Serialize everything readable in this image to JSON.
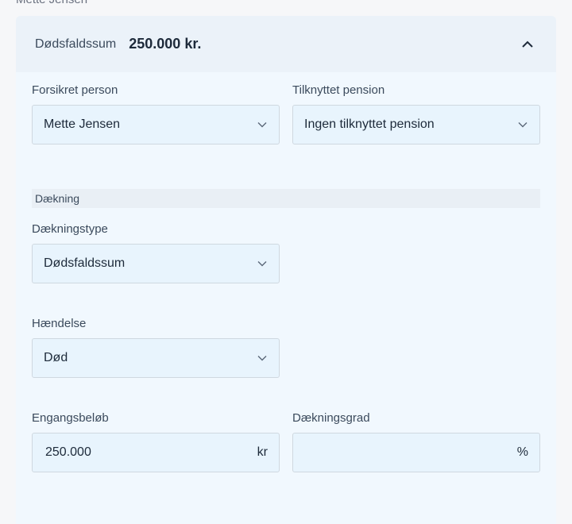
{
  "top_clip": "Mette Jensen",
  "header": {
    "label": "Dødsfaldssum",
    "value": "250.000 kr."
  },
  "fields": {
    "insured_person": {
      "label": "Forsikret person",
      "value": "Mette Jensen"
    },
    "linked_pension": {
      "label": "Tilknyttet pension",
      "value": "Ingen tilknyttet pension"
    },
    "coverage_type": {
      "label": "Dækningstype",
      "value": "Dødsfaldssum"
    },
    "event": {
      "label": "Hændelse",
      "value": "Død"
    },
    "lump_sum": {
      "label": "Engangsbeløb",
      "value": "250.000",
      "suffix": "kr"
    },
    "coverage_degree": {
      "label": "Dækningsgrad",
      "value": "",
      "suffix": "%"
    }
  },
  "section": {
    "title": "Dækning"
  },
  "icons": {
    "collapse": "chevron-up-icon",
    "dropdown": "chevron-down-icon"
  }
}
